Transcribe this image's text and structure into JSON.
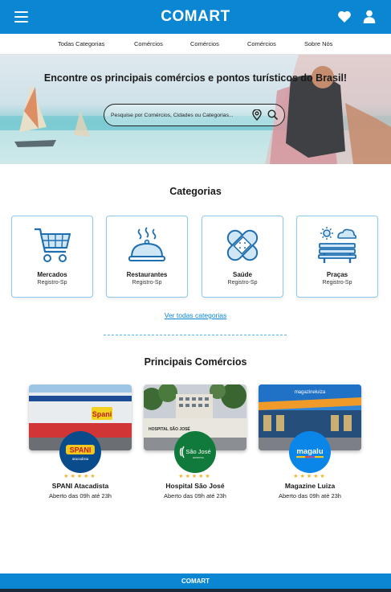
{
  "header": {
    "brand": "COMART",
    "icons": {
      "menu": "menu-icon",
      "favorites": "heart-icon",
      "account": "user-icon"
    }
  },
  "nav": {
    "items": [
      {
        "label": "Todas Categorias"
      },
      {
        "label": "Comércios"
      },
      {
        "label": "Comércios"
      },
      {
        "label": "Comércios"
      },
      {
        "label": "Sobre Nós"
      }
    ]
  },
  "hero": {
    "title": "Encontre os principais comércios e pontos turísticos do Brasil!",
    "search_placeholder": "Pesquise por Comércios, Cidades ou Categorias...",
    "icons": {
      "location": "location-pin-icon",
      "search": "search-icon"
    }
  },
  "categories": {
    "title": "Categorias",
    "items": [
      {
        "name": "Mercados",
        "location": "Registro-Sp",
        "icon": "shopping-cart-icon"
      },
      {
        "name": "Restaurantes",
        "location": "Registro-Sp",
        "icon": "food-cloche-icon"
      },
      {
        "name": "Saúde",
        "location": "Registro-Sp",
        "icon": "bandage-icon"
      },
      {
        "name": "Praças",
        "location": "Registro-Sp",
        "icon": "park-bench-icon"
      }
    ],
    "see_all": "Ver todas categorias"
  },
  "stores": {
    "title": "Principais Comércios",
    "items": [
      {
        "name": "SPANI Atacadista",
        "hours": "Aberto das 09h até 23h",
        "stars": "★★★★★",
        "rating": 5,
        "logo_text": "SPANI",
        "logo_sub": "atacadista",
        "photo_sign": "Spani",
        "logo_color": "#0a4b8c"
      },
      {
        "name": "Hospital São José",
        "hours": "Aberto das 09h até 23h",
        "stars": "★★★★★",
        "rating": 5,
        "logo_text": "São José",
        "logo_sub": "HOSPITAL",
        "photo_sign": "HOSPITAL SÃO JOSÉ",
        "logo_color": "#0f7a3a"
      },
      {
        "name": "Magazine Luiza",
        "hours": "Aberto das 09h até 23h",
        "stars": "★★★★★",
        "rating": 5,
        "logo_text": "magalu",
        "photo_sign": "magazineluiza",
        "logo_color": "#0a86e8"
      }
    ]
  },
  "footer": {
    "brand": "COMART"
  },
  "colors": {
    "primary": "#0a86d3",
    "card_border": "#8ec9ec",
    "star": "#f0b429",
    "link": "#0a86d3"
  }
}
